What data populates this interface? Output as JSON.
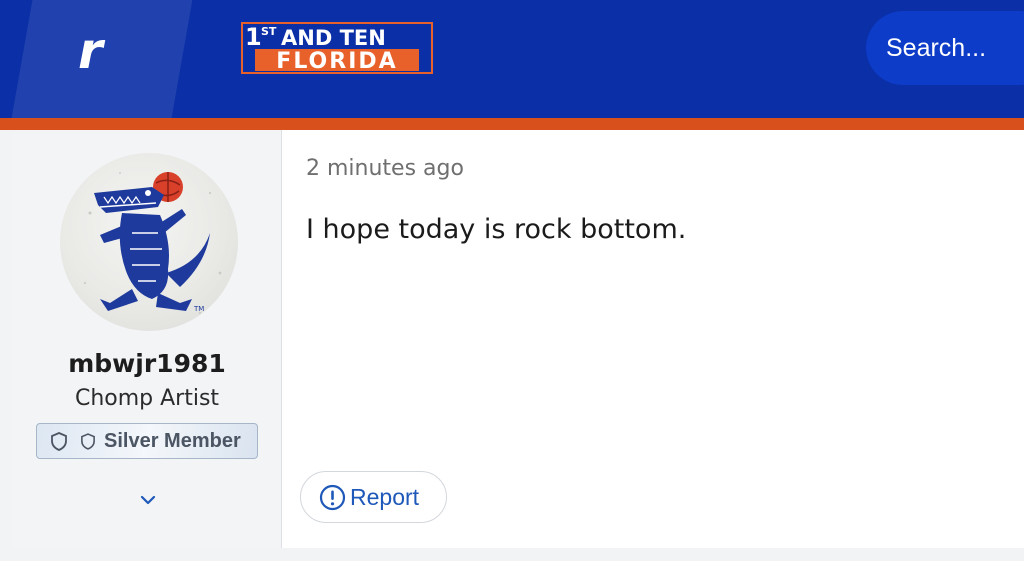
{
  "header": {
    "brand_icon": "r-logo-icon",
    "site_logo": {
      "line1_sup": "1",
      "line1_sup_suffix": "ST",
      "line1_rest": "AND TEN",
      "line2": "FLORIDA"
    },
    "search_placeholder": "Search..."
  },
  "post": {
    "author": {
      "avatar_icon": "gator-mascot-avatar",
      "username": "mbwjr1981",
      "title": "Chomp Artist",
      "badge_label": "Silver Member",
      "badge_icons": [
        "shield-icon",
        "shield-icon"
      ]
    },
    "time": "2 minutes ago",
    "body": "I hope today is rock bottom.",
    "report_label": "Report"
  },
  "colors": {
    "header_bg": "#0a2fa6",
    "accent": "#d8501c",
    "search_bg": "#0d3cc8",
    "link_blue": "#1e58b8"
  }
}
